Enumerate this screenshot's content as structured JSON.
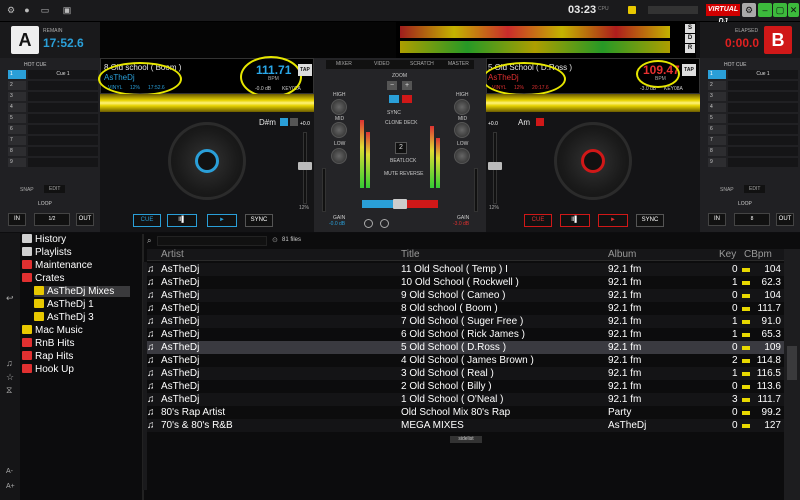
{
  "top": {
    "clock": "03:23",
    "cpu_label": "CPU",
    "logo": "VIRTUAL DJ"
  },
  "deckA": {
    "letter": "A",
    "remain_label": "REMAIN",
    "remain": "17:52.6",
    "title": "8 Old school ( Boom )",
    "artist": "AsTheDj",
    "vinyl": "VINYL",
    "pitch": "12%",
    "time": "17:52.6",
    "bpm": "111.71",
    "bpm_label": "BPM",
    "gain": "-0.0 dB",
    "key_label": "KEY",
    "key": "02A",
    "tap": "TAP",
    "keyname": "D#m",
    "pitch_pct": "+0.0",
    "pitch_range": "12%",
    "buttons": {
      "cue": "CUE",
      "play": "►",
      "sync": "SYNC",
      "pause": "II▌"
    }
  },
  "deckB": {
    "letter": "B",
    "elapsed_label": "ELAPSED",
    "elapsed": "0:00.0",
    "title": "5 Old School ( D.Ross )",
    "artist": "AsTheDj",
    "vinyl": "VINYL",
    "pitch": "12%",
    "time": "20:17.6",
    "bpm": "109.47",
    "bpm_label": "BPM",
    "gain": "-3.0 dB",
    "key_label": "KEY",
    "key": "08A",
    "tap": "TAP",
    "keyname": "Am",
    "pitch_pct": "+0.0",
    "pitch_range": "12%",
    "buttons": {
      "cue": "CUE",
      "play": "►",
      "sync": "SYNC",
      "pause": "II▌"
    }
  },
  "hotcue": {
    "title": "HOT CUE",
    "loop_title": "LOOP",
    "snap": "SNAP",
    "edit": "EDIT",
    "left_rows": [
      "Cue 1",
      "",
      "",
      "",
      "",
      "",
      "",
      "",
      ""
    ],
    "right_rows": [
      "Cue 1",
      "",
      "",
      "",
      "",
      "",
      "",
      "",
      ""
    ],
    "nums": [
      "1",
      "2",
      "3",
      "4",
      "5",
      "6",
      "7",
      "8",
      "9"
    ],
    "loop_in": "IN",
    "loop_out": "OUT",
    "loop_left": "1/2",
    "loop_right": "8"
  },
  "mixer": {
    "tabs": [
      "MIXER",
      "VIDEO",
      "SCRATCH",
      "MASTER"
    ],
    "high": "HIGH",
    "mid": "MID",
    "low": "LOW",
    "gain": "GAIN",
    "gainA": "-0.0 dB",
    "gainB": "-3.0 dB",
    "zoom": "ZOOM",
    "sync_lbl": "SYNC",
    "clone": "CLONE DECK",
    "beatlock": "BEATLOCK",
    "mute_reverse": "MUTE REVERSE",
    "beatcount": "2"
  },
  "browser": {
    "files": "81 files",
    "tree": [
      {
        "label": "History",
        "color": "#cfcfcf",
        "indent": 0
      },
      {
        "label": "Playlists",
        "color": "#cfcfcf",
        "indent": 0
      },
      {
        "label": "Maintenance",
        "color": "#e03030",
        "indent": 0
      },
      {
        "label": "Crates",
        "color": "#e03030",
        "indent": 0
      },
      {
        "label": "AsTheDj  Mixes",
        "color": "#e8c800",
        "indent": 1
      },
      {
        "label": "AsTheDj 1",
        "color": "#e8c800",
        "indent": 1
      },
      {
        "label": "AsTheDj 3",
        "color": "#e8c800",
        "indent": 1
      },
      {
        "label": "Mac Music",
        "color": "#e8c800",
        "indent": 0
      },
      {
        "label": "RnB Hits",
        "color": "#e03030",
        "indent": 0
      },
      {
        "label": "Rap Hits",
        "color": "#e03030",
        "indent": 0
      },
      {
        "label": "Hook Up",
        "color": "#e03030",
        "indent": 0
      }
    ],
    "cols": {
      "artist": "Artist",
      "title": "Title",
      "album": "Album",
      "key": "Key",
      "cbpm": "CBpm"
    },
    "rows": [
      {
        "artist": "AsTheDj",
        "title": "11 Old School ( Temp ) I",
        "album": "92.1 fm",
        "key": "0",
        "bpm": "104"
      },
      {
        "artist": "AsTheDj",
        "title": "10 Old School ( Rockwell )",
        "album": "92.1 fm",
        "key": "1",
        "bpm": "62.3"
      },
      {
        "artist": "AsTheDj",
        "title": "9 Old School ( Cameo )",
        "album": "92.1 fm",
        "key": "0",
        "bpm": "104"
      },
      {
        "artist": "AsTheDj",
        "title": "8 Old school ( Boom )",
        "album": "92.1 fm",
        "key": "0",
        "bpm": "111.7"
      },
      {
        "artist": "AsTheDj",
        "title": "7 Old School ( Suger Free )",
        "album": "92.1 fm",
        "key": "1",
        "bpm": "91.0"
      },
      {
        "artist": "AsTheDj",
        "title": "6 Old School ( Rick James )",
        "album": "92.1 fm",
        "key": "1",
        "bpm": "65.3"
      },
      {
        "artist": "AsTheDj",
        "title": "5 Old School ( D.Ross )",
        "album": "92.1 fm",
        "key": "0",
        "bpm": "109"
      },
      {
        "artist": "AsTheDj",
        "title": "4 Old School ( James Brown )",
        "album": "92.1 fm",
        "key": "2",
        "bpm": "114.8"
      },
      {
        "artist": "AsTheDj",
        "title": "3 Old School ( Real )",
        "album": "92.1 fm",
        "key": "1",
        "bpm": "116.5"
      },
      {
        "artist": "AsTheDj",
        "title": "2 Old School ( Billy )",
        "album": "92.1 fm",
        "key": "0",
        "bpm": "113.6"
      },
      {
        "artist": "AsTheDj",
        "title": "1 Old School ( O'Neal )",
        "album": "92.1 fm",
        "key": "3",
        "bpm": "111.7"
      },
      {
        "artist": "80's Rap Artist",
        "title": "Old School Mix 80's Rap",
        "album": "Party",
        "key": "0",
        "bpm": "99.2"
      },
      {
        "artist": "70's & 80's R&B",
        "title": "MEGA MIXES",
        "album": "AsTheDj",
        "key": "0",
        "bpm": "127"
      }
    ],
    "sidelist": "sidelist",
    "leftfx": [
      "A-",
      "A+"
    ]
  },
  "colors": {
    "accentA": "#2a9fd8",
    "accentB": "#d01818",
    "wave": "#e6d200"
  }
}
